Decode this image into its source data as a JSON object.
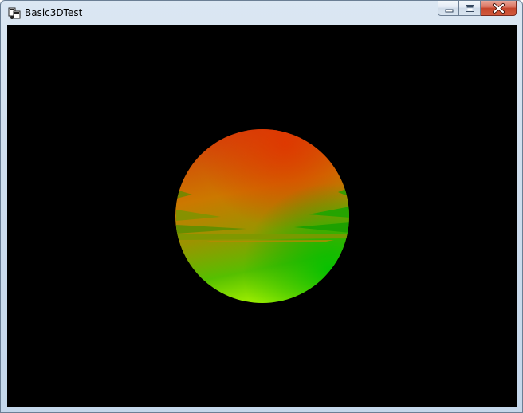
{
  "window": {
    "title": "Basic3DTest",
    "icon": "app-window-icon"
  },
  "caption_buttons": {
    "minimize_icon": "minimize-icon",
    "maximize_icon": "maximize-icon",
    "close_icon": "close-icon"
  },
  "viewport": {
    "background": "#000000",
    "object": "shaded-sphere",
    "colors": {
      "top": "#d83a00",
      "middle": "#c88a00",
      "lower_right": "#08b800",
      "bottom": "#9cf000"
    }
  }
}
